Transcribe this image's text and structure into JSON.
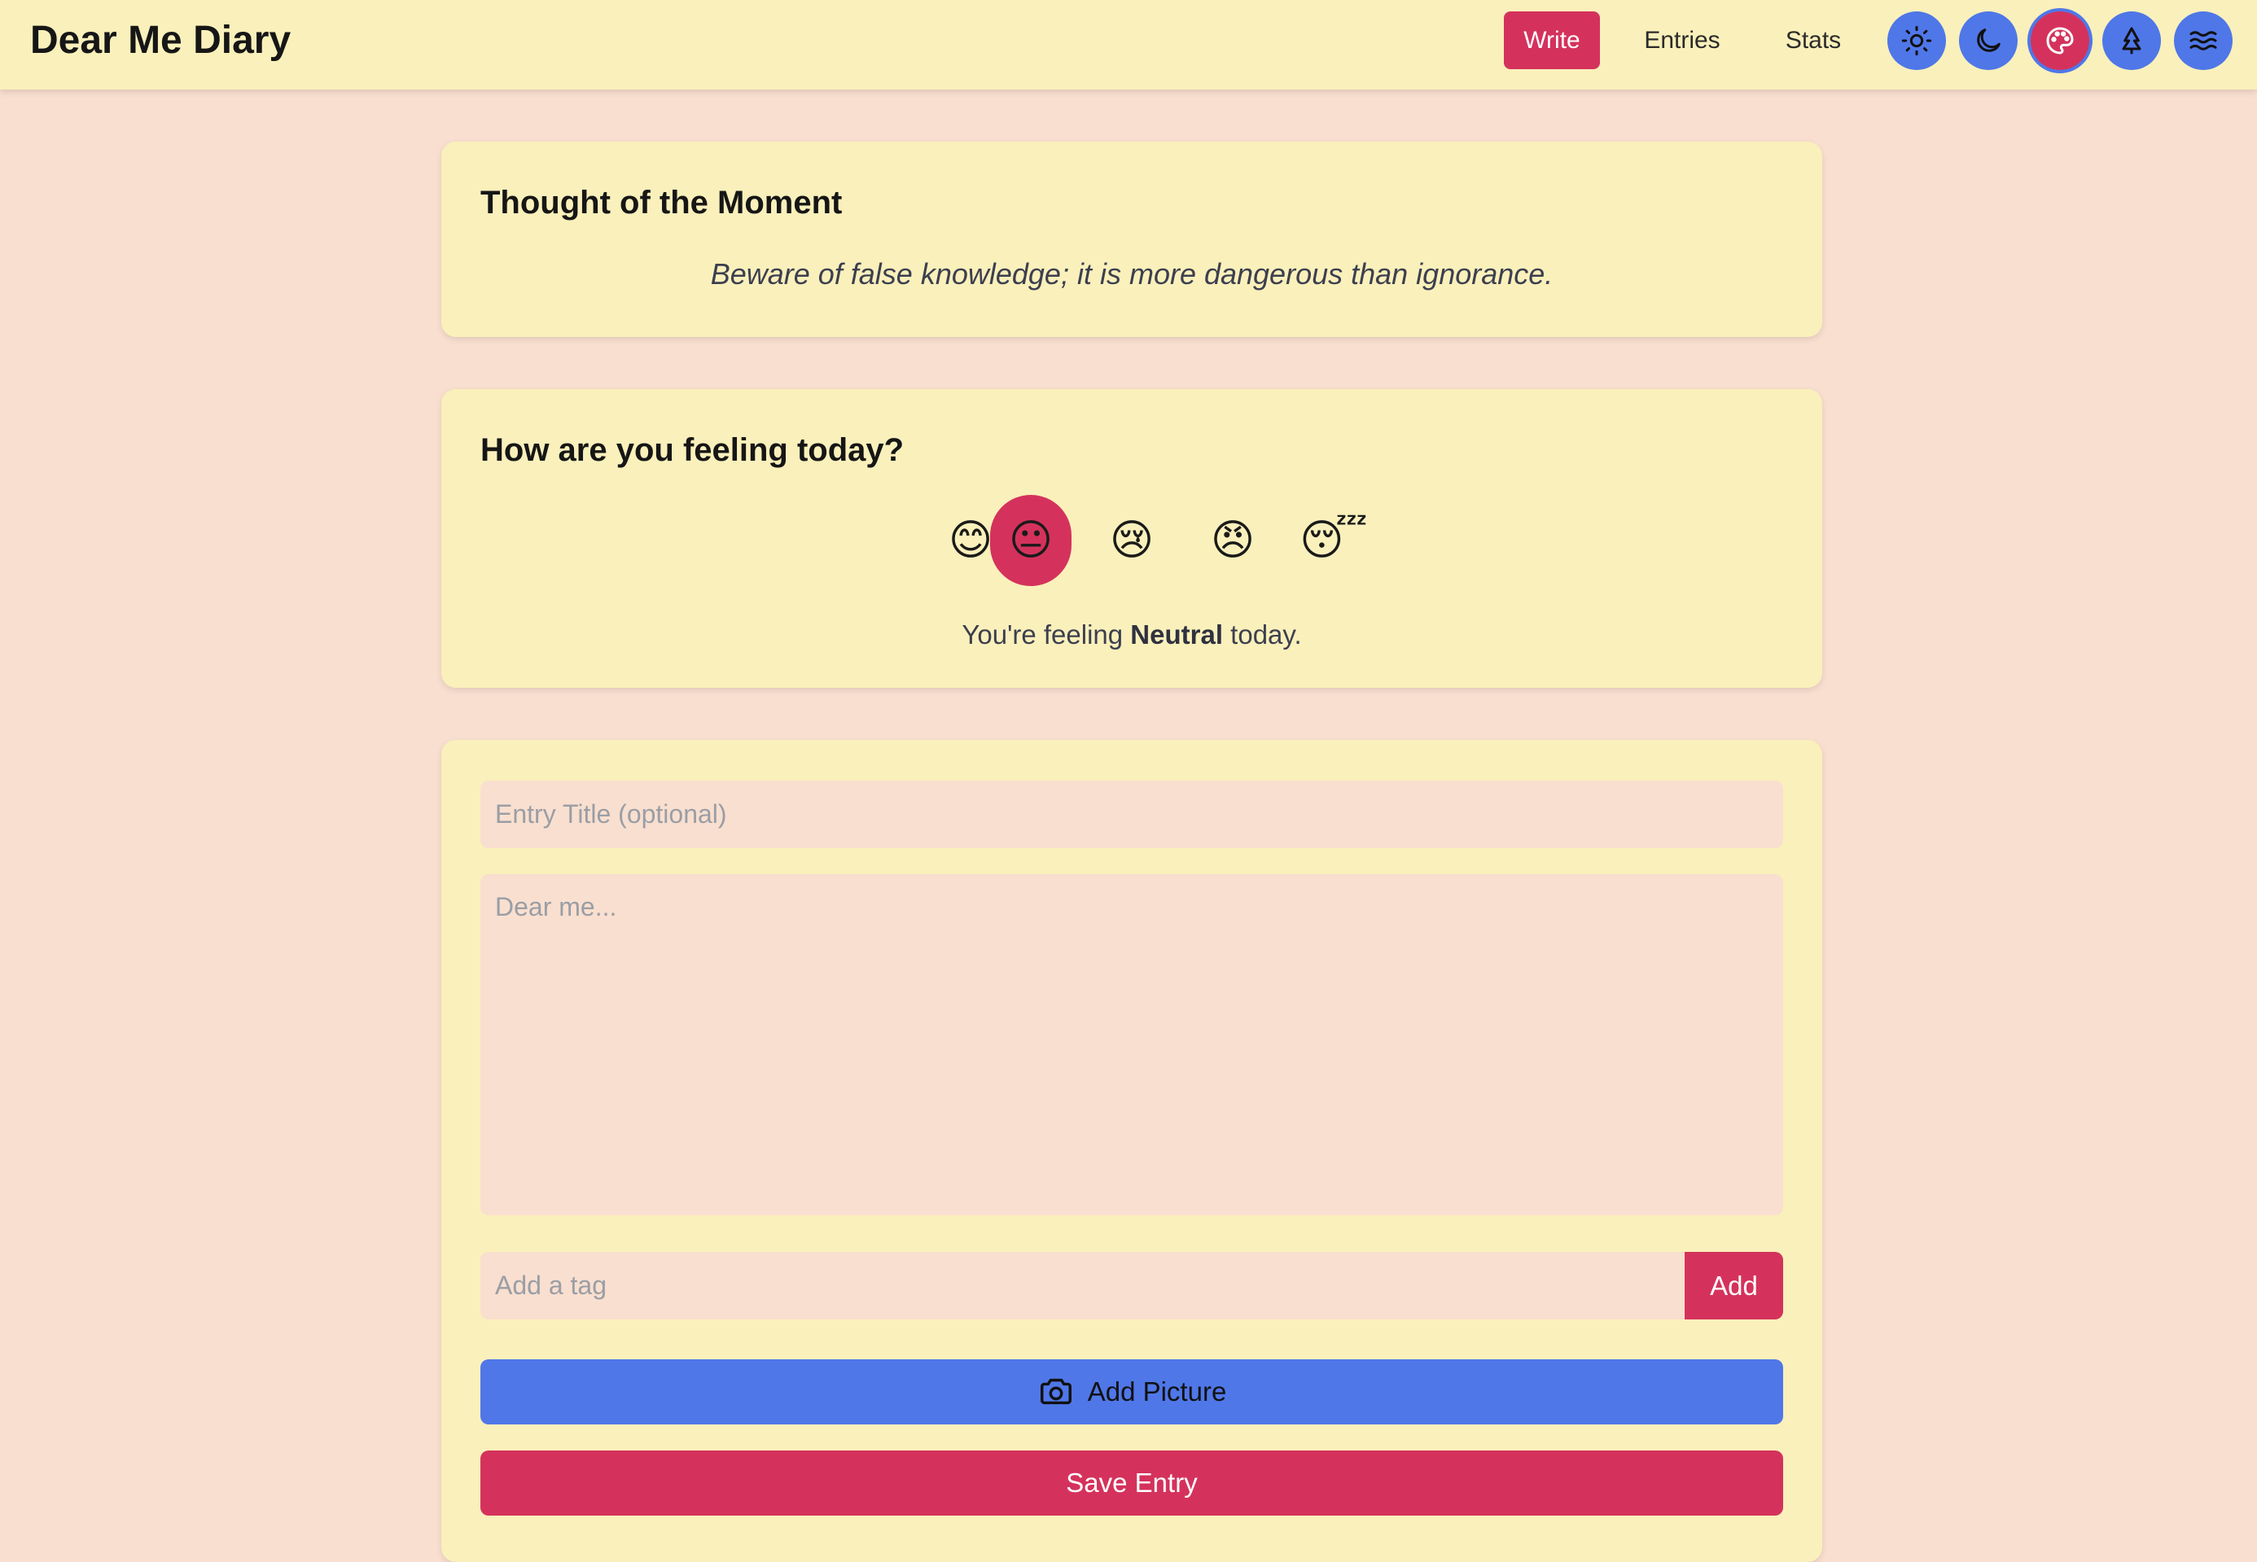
{
  "header": {
    "app_title": "Dear Me Diary",
    "nav": {
      "write": "Write",
      "entries": "Entries",
      "stats": "Stats"
    },
    "theme_buttons": [
      "sun-icon",
      "moon-icon",
      "palette-icon",
      "tree-icon",
      "waves-icon"
    ],
    "selected_theme": "palette-icon"
  },
  "quote_card": {
    "title": "Thought of the Moment",
    "quote": "Beware of false knowledge; it is more dangerous than ignorance."
  },
  "mood_card": {
    "title": "How are you feeling today?",
    "moods": [
      {
        "name": "Happy",
        "emoji": "😊"
      },
      {
        "name": "Neutral",
        "emoji": "😐"
      },
      {
        "name": "Sad",
        "emoji": "😢"
      },
      {
        "name": "Angry",
        "emoji": "😠"
      },
      {
        "name": "Tired",
        "emoji": "😴"
      }
    ],
    "selected_mood": "Neutral",
    "status_prefix": "You're feeling",
    "status_mood": "Neutral",
    "status_suffix": "today."
  },
  "entry_form": {
    "title_placeholder": "Entry Title (optional)",
    "title_value": "",
    "body_placeholder": "Dear me...",
    "body_value": "",
    "tag_placeholder": "Add a tag",
    "tag_value": "",
    "add_tag_label": "Add",
    "add_picture_label": "Add Picture",
    "save_label": "Save Entry"
  },
  "colors": {
    "page_bg": "#f9dfcf",
    "card_bg": "#faf0bb",
    "accent_red": "#d4325c",
    "accent_blue": "#4f77e8"
  }
}
